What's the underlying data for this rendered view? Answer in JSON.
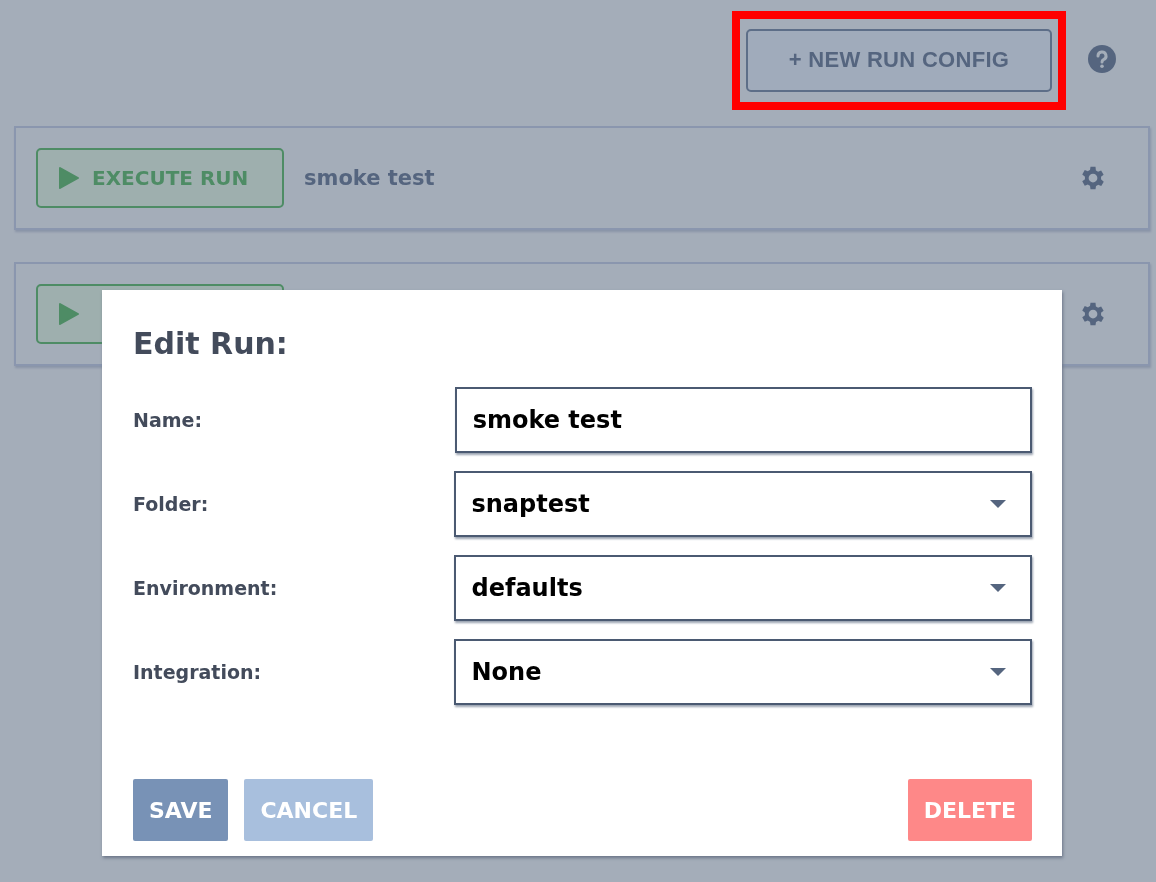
{
  "toolbar": {
    "new_button": "+ NEW RUN CONFIG",
    "highlighted": true
  },
  "runs": [
    {
      "kind": "full",
      "button": "EXECUTE RUN",
      "name": "smoke test"
    },
    {
      "kind": "covered"
    }
  ],
  "dialog": {
    "title": "Edit Run:",
    "fields": [
      {
        "kind": "text",
        "label": "Name:",
        "value": "smoke test"
      },
      {
        "kind": "select",
        "label": "Folder:",
        "value": "snaptest"
      },
      {
        "kind": "select",
        "label": "Environment:",
        "value": "defaults"
      },
      {
        "kind": "select",
        "label": "Integration:",
        "value": "None"
      }
    ],
    "buttons": [
      {
        "kind": "primary",
        "label": "SAVE"
      },
      {
        "kind": "secondary",
        "label": "CANCEL"
      },
      {
        "kind": "danger",
        "label": "DELETE"
      }
    ]
  }
}
